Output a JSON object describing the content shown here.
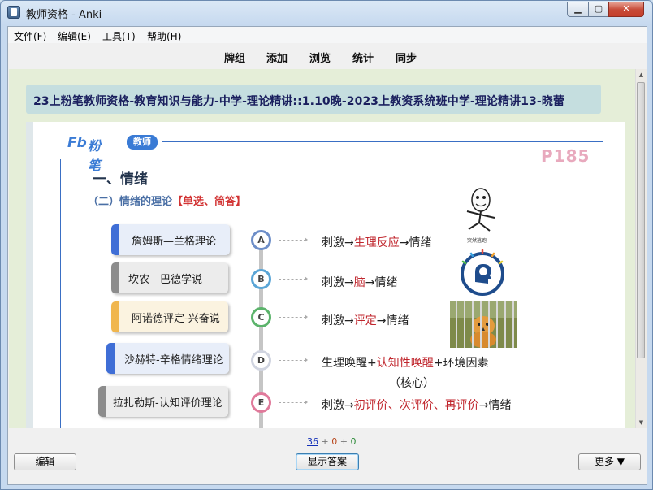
{
  "window": {
    "title": "教师资格 - Anki",
    "min_glyph": "▁",
    "max_glyph": "▢",
    "close_glyph": "✕"
  },
  "menu": [
    {
      "label": "文件(F)"
    },
    {
      "label": "编辑(E)"
    },
    {
      "label": "工具(T)"
    },
    {
      "label": "帮助(H)"
    }
  ],
  "toolbar": [
    {
      "label": "牌组"
    },
    {
      "label": "添加"
    },
    {
      "label": "浏览"
    },
    {
      "label": "统计"
    },
    {
      "label": "同步"
    }
  ],
  "card": {
    "deck_path": "23上粉笔教师资格-教育知识与能力-中学-理论精讲::1.10晚-2023上教资系统班中学-理论精讲13-晓蕾",
    "slide": {
      "logo_fb": "Fb",
      "logo_brand": "粉笔",
      "logo_tag": "教师",
      "page_code": "P185",
      "heading": "一、情绪",
      "subheading": "（二）情绪的理论",
      "subheading_tag": "【单选、简答】",
      "theories": [
        {
          "name": "詹姆斯—兰格理论",
          "letter": "A",
          "accent": "#3f6ed6",
          "formula": [
            {
              "t": "刺激→"
            },
            {
              "t": "生理反应",
              "red": true
            },
            {
              "t": "→情绪"
            }
          ]
        },
        {
          "name": "坎农—巴德学说",
          "letter": "B",
          "accent": "#8c8c8c",
          "formula": [
            {
              "t": "刺激→"
            },
            {
              "t": "脑",
              "red": true
            },
            {
              "t": "→情绪"
            }
          ]
        },
        {
          "name": "阿诺德评定-兴奋说",
          "letter": "C",
          "accent": "#f0b64e",
          "formula": [
            {
              "t": "刺激→"
            },
            {
              "t": "评定",
              "red": true
            },
            {
              "t": "→情绪"
            }
          ]
        },
        {
          "name": "沙赫特-辛格情绪理论",
          "letter": "D",
          "accent": "#3f6ed6",
          "formula": [
            {
              "t": "生理唤醒+"
            },
            {
              "t": "认知性唤醒",
              "red": true
            },
            {
              "t": "+环境因素"
            }
          ],
          "note": "（核心）"
        },
        {
          "name": "拉扎勒斯-认知评价理论",
          "letter": "E",
          "accent": "#8c8c8c",
          "formula": [
            {
              "t": "刺激→"
            },
            {
              "t": "初评价、次评价、再评价",
              "red": true
            },
            {
              "t": "→情绪"
            }
          ]
        }
      ],
      "illustrations": [
        {
          "name": "running-man-meme",
          "caption": "突然逃跑"
        },
        {
          "name": "brain-icon"
        },
        {
          "name": "caged-tiger-image"
        }
      ]
    }
  },
  "bottom": {
    "count_new": "36",
    "count_learning": "0",
    "count_review": "0",
    "separator": "+",
    "edit_button": "编辑",
    "show_answer_button": "显示答案",
    "more_button": "更多 ▼"
  },
  "colors": {
    "deck_banner_bg": "#c5dedf",
    "reviewer_bg": "#e5eed8",
    "red_highlight": "#c0262d",
    "brand_blue": "#3a7bd5",
    "frame_blue": "#3a6fc4"
  }
}
